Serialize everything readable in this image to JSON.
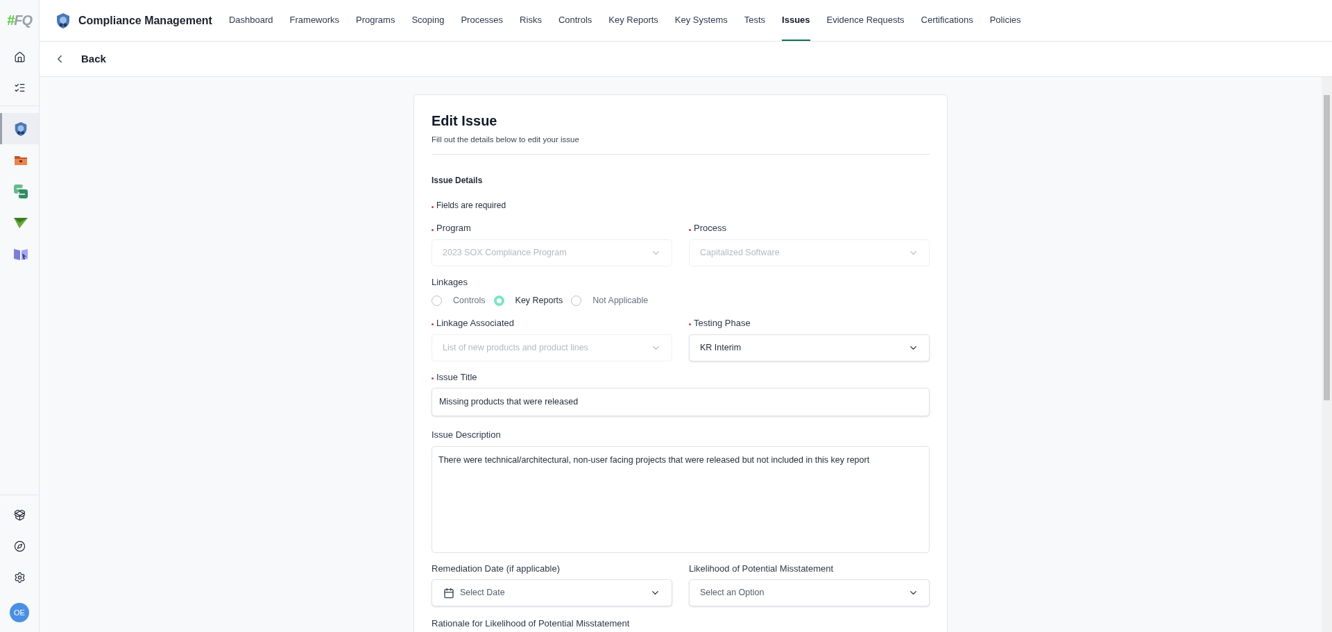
{
  "sidebar": {
    "logo": "#FQ",
    "top_items": [
      {
        "kind": "home"
      },
      {
        "kind": "tasks"
      }
    ],
    "apps": [
      {
        "kind": "shield",
        "selected": true
      },
      {
        "kind": "folder",
        "selected": false
      },
      {
        "kind": "sync",
        "selected": false
      },
      {
        "kind": "plane",
        "selected": false
      },
      {
        "kind": "book",
        "selected": false
      }
    ],
    "bottom_items": [
      {
        "kind": "box"
      },
      {
        "kind": "compass"
      },
      {
        "kind": "settings"
      }
    ],
    "avatar": "OE"
  },
  "header": {
    "title": "Compliance Management",
    "nav": [
      {
        "label": "Dashboard",
        "selected": false
      },
      {
        "label": "Frameworks",
        "selected": false
      },
      {
        "label": "Programs",
        "selected": false
      },
      {
        "label": "Scoping",
        "selected": false
      },
      {
        "label": "Processes",
        "selected": false
      },
      {
        "label": "Risks",
        "selected": false
      },
      {
        "label": "Controls",
        "selected": false
      },
      {
        "label": "Key Reports",
        "selected": false
      },
      {
        "label": "Key Systems",
        "selected": false
      },
      {
        "label": "Tests",
        "selected": false
      },
      {
        "label": "Issues",
        "selected": true
      },
      {
        "label": "Evidence Requests",
        "selected": false
      },
      {
        "label": "Certifications",
        "selected": false
      },
      {
        "label": "Policies",
        "selected": false
      }
    ]
  },
  "back": "Back",
  "form": {
    "title": "Edit Issue",
    "subtitle": "Fill out the details below to edit your issue",
    "section": "Issue Details",
    "required_note": "Fields are required",
    "rows": [
      [
        {
          "kind": "select",
          "label": "Program",
          "required": true,
          "value": "2023 SOX Compliance Program",
          "disabled": true
        },
        {
          "kind": "select",
          "label": "Process",
          "required": true,
          "value": "Capitalized Software",
          "disabled": true
        }
      ],
      [
        {
          "kind": "radio",
          "label": "Linkages",
          "required": false,
          "options": [
            {
              "label": "Controls",
              "selected": false
            },
            {
              "label": "Key Reports",
              "selected": true
            },
            {
              "label": "Not Applicable",
              "selected": false
            }
          ]
        }
      ],
      [
        {
          "kind": "select",
          "label": "Linkage Associated",
          "required": true,
          "value": "List of new products and product lines",
          "disabled": true
        },
        {
          "kind": "select",
          "label": "Testing Phase",
          "required": true,
          "value": "KR Interim",
          "disabled": false
        }
      ],
      [
        {
          "kind": "input",
          "label": "Issue Title",
          "required": true,
          "value": "Missing products that were released"
        }
      ],
      [
        {
          "kind": "textarea",
          "label": "Issue Description",
          "required": false,
          "value": "There were technical/architectural, non-user facing projects that were released but not included in this key report"
        }
      ],
      [
        {
          "kind": "date",
          "label": "Remediation Date (if applicable)",
          "required": false,
          "placeholder": "Select Date"
        },
        {
          "kind": "select",
          "label": "Likelihood of Potential Misstatement",
          "required": false,
          "placeholder": "Select an Option",
          "disabled": false
        }
      ],
      [
        {
          "kind": "label",
          "label": "Rationale for Likelihood of Potential Misstatement",
          "required": false
        }
      ]
    ]
  }
}
